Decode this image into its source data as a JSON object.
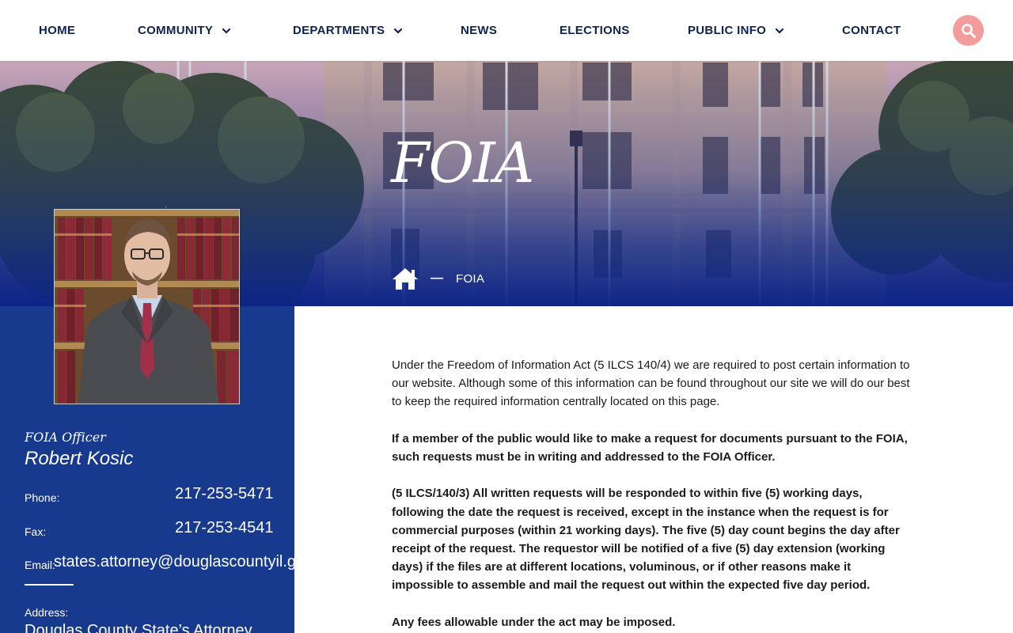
{
  "nav": {
    "items": [
      {
        "label": "HOME",
        "dropdown": false
      },
      {
        "label": "COMMUNITY",
        "dropdown": true
      },
      {
        "label": "DEPARTMENTS",
        "dropdown": true
      },
      {
        "label": "NEWS",
        "dropdown": false
      },
      {
        "label": "ELECTIONS",
        "dropdown": false
      },
      {
        "label": "PUBLIC INFO",
        "dropdown": true
      },
      {
        "label": "CONTACT",
        "dropdown": false
      }
    ],
    "search_icon": "search-icon"
  },
  "hero": {
    "title": "FOIA",
    "breadcrumb": {
      "home_icon": "home-icon",
      "separator": "—",
      "current": "FOIA"
    }
  },
  "sidebar": {
    "role": "FOIA Officer",
    "name": "Robert Kosic",
    "phone_label": "Phone:",
    "phone": "217-253-5471",
    "fax_label": "Fax:",
    "fax": "217-253-4541",
    "email_label": "Email:",
    "email": "states.attorney@douglascountyil.gov",
    "address_label": "Address:",
    "address_line1": "Douglas County State’s Attorney"
  },
  "content": {
    "paragraphs": [
      {
        "text": "Under the Freedom of Information Act (5 ILCS 140/4) we are required to post certain information to our website. Although some of this information can be found throughout our site we will do our best to keep the required information centrally located on this page.",
        "bold": false
      },
      {
        "text": "If a member of the public would like to make a request for documents pursuant to the FOIA, such requests must be in writing and addressed to the FOIA Officer.",
        "bold": true
      },
      {
        "text": "(5 ILCS/140/3) All written requests will be responded to within five (5) working days, following the date the request is received, except in the instance when the request is for commercial purposes (within 21 working days). The five (5) day count begins the day after receipt of the request. The requestor will be notified of a five (5) day extension (working days) if the files are at different locations, voluminous, or if other reasons make it impossible to assemble and mail the request out within the expected five day period.",
        "bold": true
      },
      {
        "text": "Any fees allowable under the act may be imposed.",
        "bold": true
      }
    ]
  },
  "colors": {
    "nav_text": "#0f2350",
    "search_button": "#f49b9b",
    "sidebar_bg": "#183a8e",
    "hero_overlay_bottom": "#0e2a86"
  }
}
